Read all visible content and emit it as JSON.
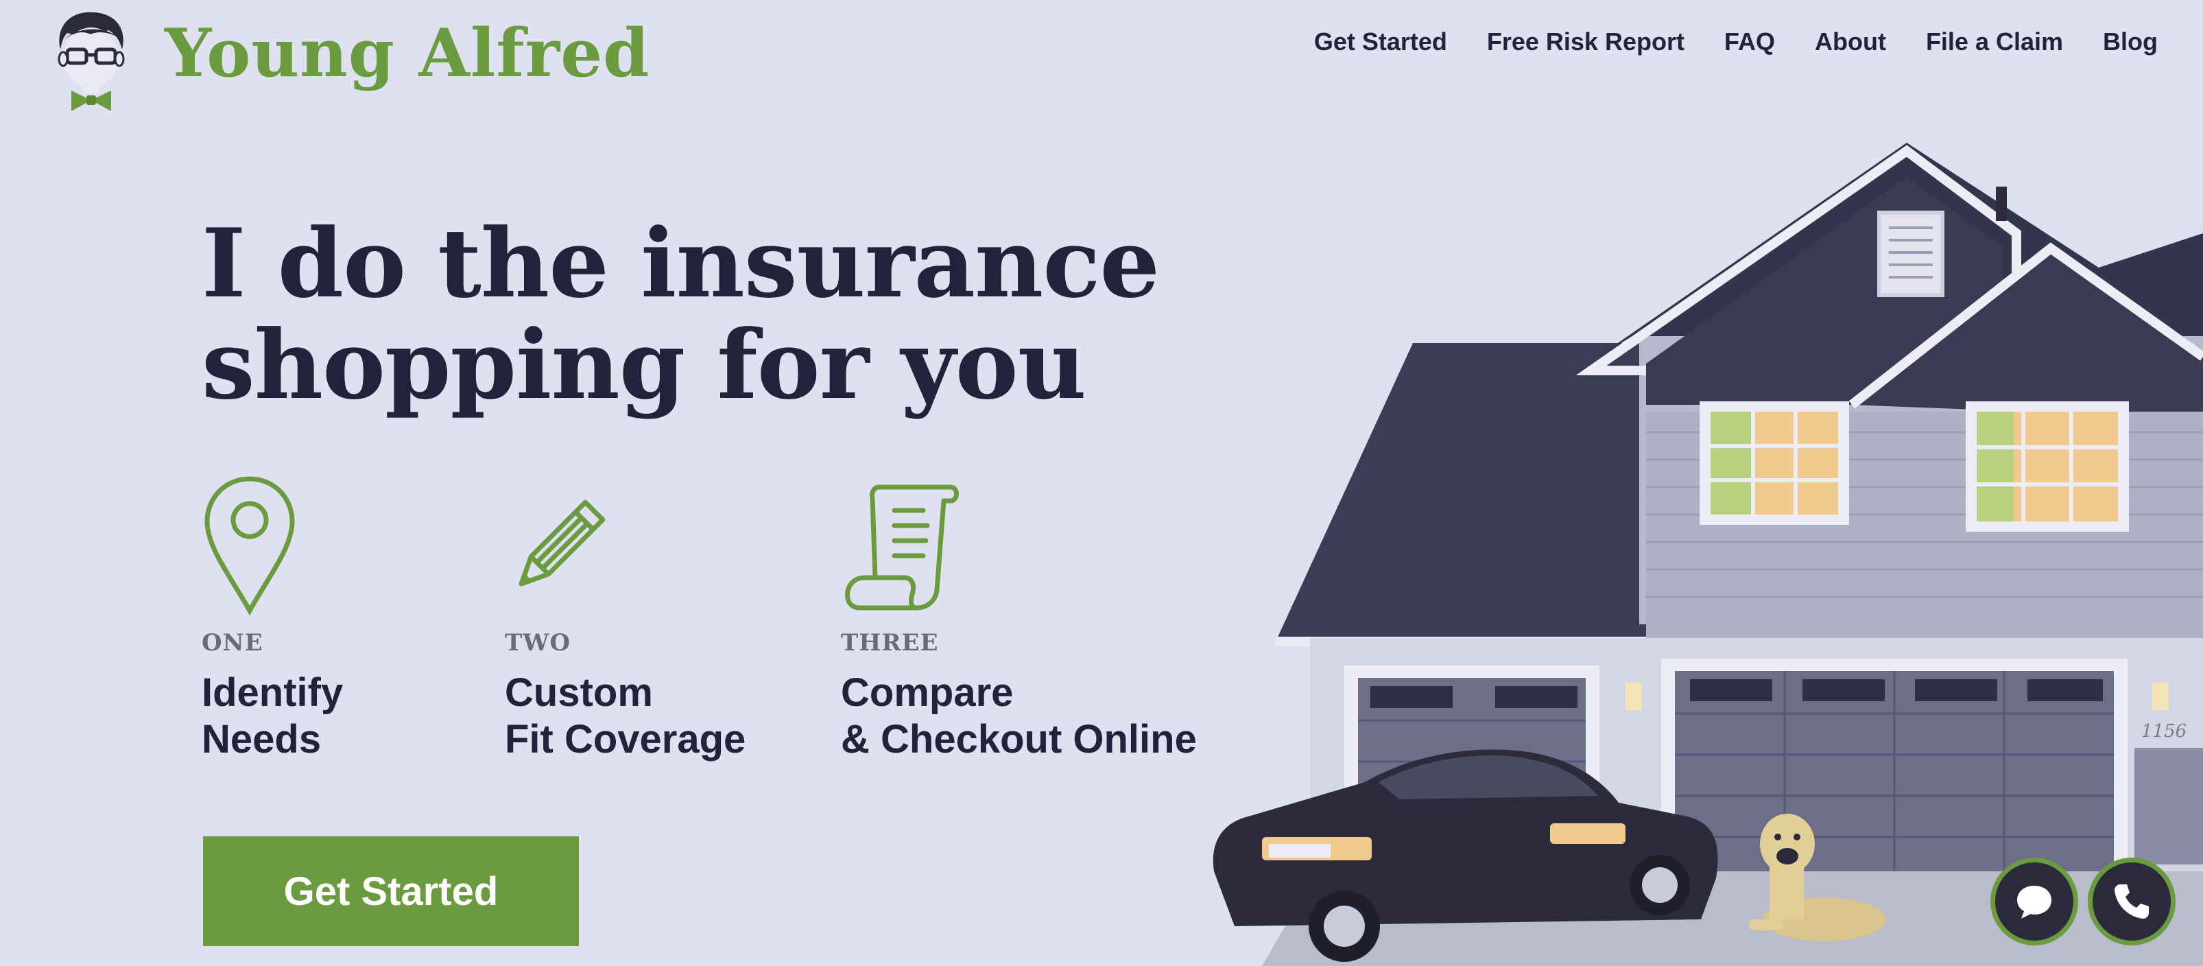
{
  "header": {
    "brand": "Young Alfred",
    "nav": [
      "Get Started",
      "Free Risk Report",
      "FAQ",
      "About",
      "File a Claim",
      "Blog"
    ]
  },
  "hero": {
    "headline_line1": "I do the insurance",
    "headline_line2": "shopping for you",
    "steps": [
      {
        "number": "ONE",
        "line1": "Identify",
        "line2": "Needs",
        "icon": "map-pin-icon"
      },
      {
        "number": "TWO",
        "line1": "Custom",
        "line2": "Fit Coverage",
        "icon": "pencil-icon"
      },
      {
        "number": "THREE",
        "line1": "Compare",
        "line2": "& Checkout Online",
        "icon": "scroll-icon"
      }
    ],
    "cta_label": "Get Started"
  },
  "illustration": {
    "house_number": "1156"
  },
  "colors": {
    "brand_green": "#6b9b3f",
    "text_dark": "#22223a",
    "background": "#dfe1f1"
  }
}
